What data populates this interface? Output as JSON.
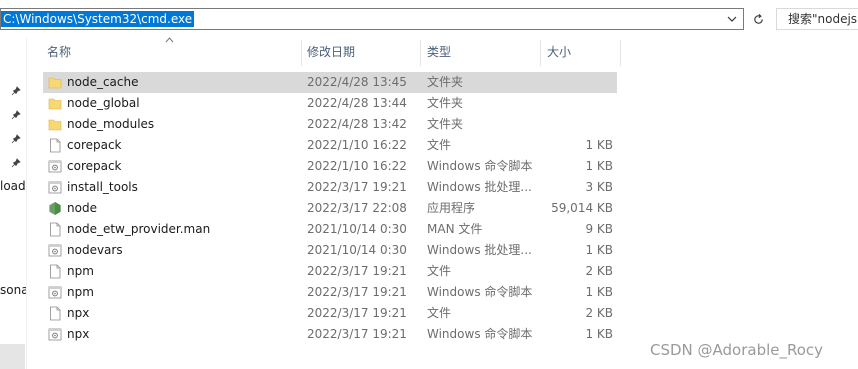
{
  "address_bar": {
    "path": "C:\\Windows\\System32\\cmd.exe"
  },
  "search": {
    "placeholder": "搜索\"nodejs\""
  },
  "nav_pane": {
    "clipped_items": [
      "load",
      "sona"
    ]
  },
  "columns": {
    "name": "名称",
    "date": "修改日期",
    "type": "类型",
    "size": "大小"
  },
  "rows": [
    {
      "icon": "folder-icon",
      "name": "node_cache",
      "date": "2022/4/28 13:45",
      "type": "文件夹",
      "size": "",
      "selected": true
    },
    {
      "icon": "folder-icon",
      "name": "node_global",
      "date": "2022/4/28 13:44",
      "type": "文件夹",
      "size": ""
    },
    {
      "icon": "folder-icon",
      "name": "node_modules",
      "date": "2022/4/28 13:42",
      "type": "文件夹",
      "size": ""
    },
    {
      "icon": "file-icon",
      "name": "corepack",
      "date": "2022/1/10 16:22",
      "type": "文件",
      "size": "1 KB"
    },
    {
      "icon": "script-icon",
      "name": "corepack",
      "date": "2022/1/10 16:22",
      "type": "Windows 命令脚本",
      "size": "1 KB"
    },
    {
      "icon": "script-icon",
      "name": "install_tools",
      "date": "2022/3/17 19:21",
      "type": "Windows 批处理...",
      "size": "3 KB"
    },
    {
      "icon": "nodejs-app-icon",
      "name": "node",
      "date": "2022/3/17 22:08",
      "type": "应用程序",
      "size": "59,014 KB"
    },
    {
      "icon": "file-icon",
      "name": "node_etw_provider.man",
      "date": "2021/10/14 0:30",
      "type": "MAN 文件",
      "size": "9 KB"
    },
    {
      "icon": "script-icon",
      "name": "nodevars",
      "date": "2021/10/14 0:30",
      "type": "Windows 批处理...",
      "size": "1 KB"
    },
    {
      "icon": "file-icon",
      "name": "npm",
      "date": "2022/3/17 19:21",
      "type": "文件",
      "size": "2 KB"
    },
    {
      "icon": "script-icon",
      "name": "npm",
      "date": "2022/3/17 19:21",
      "type": "Windows 命令脚本",
      "size": "1 KB"
    },
    {
      "icon": "file-icon",
      "name": "npx",
      "date": "2022/3/17 19:21",
      "type": "文件",
      "size": "2 KB"
    },
    {
      "icon": "script-icon",
      "name": "npx",
      "date": "2022/3/17 19:21",
      "type": "Windows 命令脚本",
      "size": "1 KB"
    }
  ],
  "watermark": "CSDN @Adorable_Rocy",
  "colors": {
    "selection": "#0078d7",
    "row_selected": "#d9d9d9",
    "header_text": "#4c607a",
    "folder": "#f8d775",
    "node_green": "#68a063"
  }
}
